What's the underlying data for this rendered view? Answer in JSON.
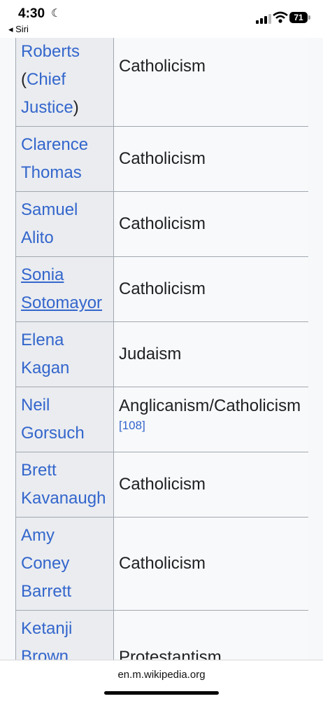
{
  "status": {
    "time": "4:30",
    "back_label": "◂ Siri",
    "battery": "71",
    "moon_icon": "moon-icon",
    "signal_icon": "cellular-signal-icon",
    "wifi_icon": "wifi-icon"
  },
  "rows": [
    {
      "name_lines": [
        "Roberts",
        "(Chief",
        "Justice)"
      ],
      "religion": "Catholicism"
    },
    {
      "name_lines": [
        "Clarence",
        "Thomas"
      ],
      "religion": "Catholicism"
    },
    {
      "name_lines": [
        "Samuel",
        "Alito"
      ],
      "religion": "Catholicism"
    },
    {
      "name_lines": [
        "Sonia",
        "Sotomayor"
      ],
      "religion": "Catholicism"
    },
    {
      "name_lines": [
        "Elena",
        "Kagan"
      ],
      "religion": "Judaism"
    },
    {
      "name_lines": [
        "Neil",
        "Gorsuch"
      ],
      "religion": "Anglicanism/Catholicism",
      "ref": "[108]"
    },
    {
      "name_lines": [
        "Brett",
        "Kavanaugh"
      ],
      "religion": "Catholicism"
    },
    {
      "name_lines": [
        "Amy",
        "Coney",
        "Barrett"
      ],
      "religion": "Catholicism"
    },
    {
      "name_lines": [
        "Ketanji",
        "Brown"
      ],
      "religion": "Protestantism"
    }
  ],
  "roberts_parts": {
    "open": "(",
    "chief": "Chief",
    "justice": "Justice",
    "close": ")"
  },
  "url": "en.m.wikipedia.org"
}
